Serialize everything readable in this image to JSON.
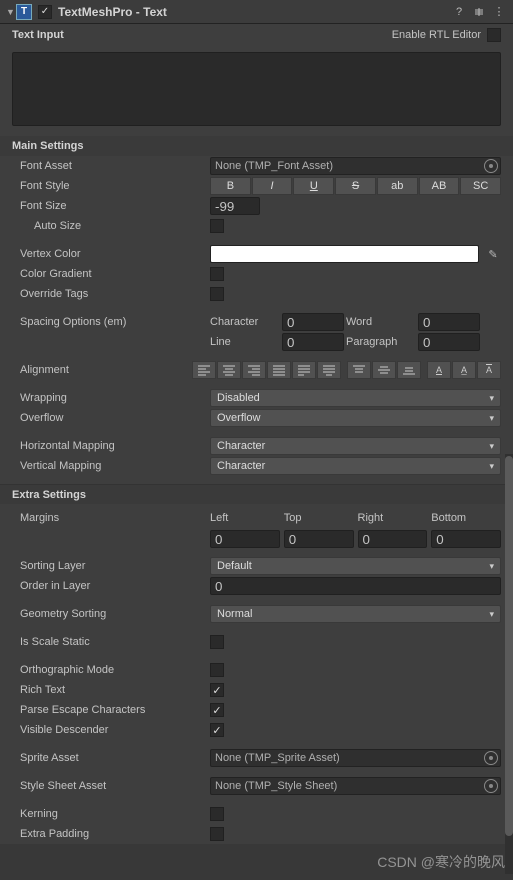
{
  "header": {
    "icon_text": "T",
    "enabled": true,
    "title": "TextMeshPro - Text"
  },
  "text_input": {
    "section_label": "Text Input",
    "rtl_label": "Enable RTL Editor",
    "rtl_enabled": false,
    "value": ""
  },
  "main": {
    "section_label": "Main Settings",
    "font_asset": {
      "label": "Font Asset",
      "value": "None (TMP_Font Asset)"
    },
    "font_style": {
      "label": "Font Style",
      "buttons": [
        "B",
        "I",
        "U",
        "S",
        "ab",
        "AB",
        "SC"
      ]
    },
    "font_size": {
      "label": "Font Size",
      "value": "-99"
    },
    "auto_size": {
      "label": "Auto Size",
      "value": false
    },
    "vertex_color": {
      "label": "Vertex Color",
      "value": "#ffffff"
    },
    "color_gradient": {
      "label": "Color Gradient",
      "value": false
    },
    "override_tags": {
      "label": "Override Tags",
      "value": false
    },
    "spacing": {
      "label": "Spacing Options (em)",
      "character": {
        "label": "Character",
        "value": "0"
      },
      "word": {
        "label": "Word",
        "value": "0"
      },
      "line": {
        "label": "Line",
        "value": "0"
      },
      "paragraph": {
        "label": "Paragraph",
        "value": "0"
      }
    },
    "alignment": {
      "label": "Alignment"
    },
    "wrapping": {
      "label": "Wrapping",
      "value": "Disabled"
    },
    "overflow": {
      "label": "Overflow",
      "value": "Overflow"
    },
    "h_mapping": {
      "label": "Horizontal Mapping",
      "value": "Character"
    },
    "v_mapping": {
      "label": "Vertical Mapping",
      "value": "Character"
    }
  },
  "extra": {
    "section_label": "Extra Settings",
    "margins": {
      "label": "Margins",
      "left": {
        "label": "Left",
        "value": "0"
      },
      "top": {
        "label": "Top",
        "value": "0"
      },
      "right": {
        "label": "Right",
        "value": "0"
      },
      "bottom": {
        "label": "Bottom",
        "value": "0"
      }
    },
    "sorting_layer": {
      "label": "Sorting Layer",
      "value": "Default"
    },
    "order_in_layer": {
      "label": "Order in Layer",
      "value": "0"
    },
    "geometry_sorting": {
      "label": "Geometry Sorting",
      "value": "Normal"
    },
    "is_scale_static": {
      "label": "Is Scale Static",
      "value": false
    },
    "orthographic": {
      "label": "Orthographic Mode",
      "value": false
    },
    "rich_text": {
      "label": "Rich Text",
      "value": true
    },
    "parse_escape": {
      "label": "Parse Escape Characters",
      "value": true
    },
    "visible_descender": {
      "label": "Visible Descender",
      "value": true
    },
    "sprite_asset": {
      "label": "Sprite Asset",
      "value": "None (TMP_Sprite Asset)"
    },
    "style_sheet": {
      "label": "Style Sheet Asset",
      "value": "None (TMP_Style Sheet)"
    },
    "kerning": {
      "label": "Kerning",
      "value": false
    },
    "extra_padding": {
      "label": "Extra Padding",
      "value": false
    }
  },
  "watermark": "CSDN @寒冷的晚风"
}
